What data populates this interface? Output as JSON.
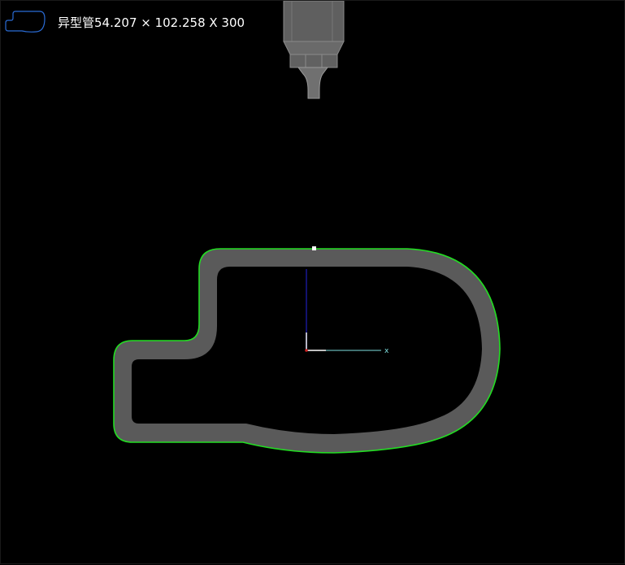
{
  "header": {
    "profile_icon": "profile-outline-icon",
    "title": "异型管54.207 × 102.258 X 300"
  },
  "colors": {
    "background": "#000000",
    "tube_fill": "#5a5a5a",
    "outline": "#22dd22",
    "thumbnail_outline": "#2a6cd6",
    "axis_x": "#7fe0e0",
    "axis_y": "#1a1aa0",
    "axis_origin": "#cc2222",
    "tool_body": "#6b6b6b",
    "tool_edge": "#9a9a9a",
    "title_text": "#ffffff"
  },
  "scene": {
    "tool_icon": "cutting-head-icon",
    "axis": {
      "x_label": "x"
    }
  }
}
